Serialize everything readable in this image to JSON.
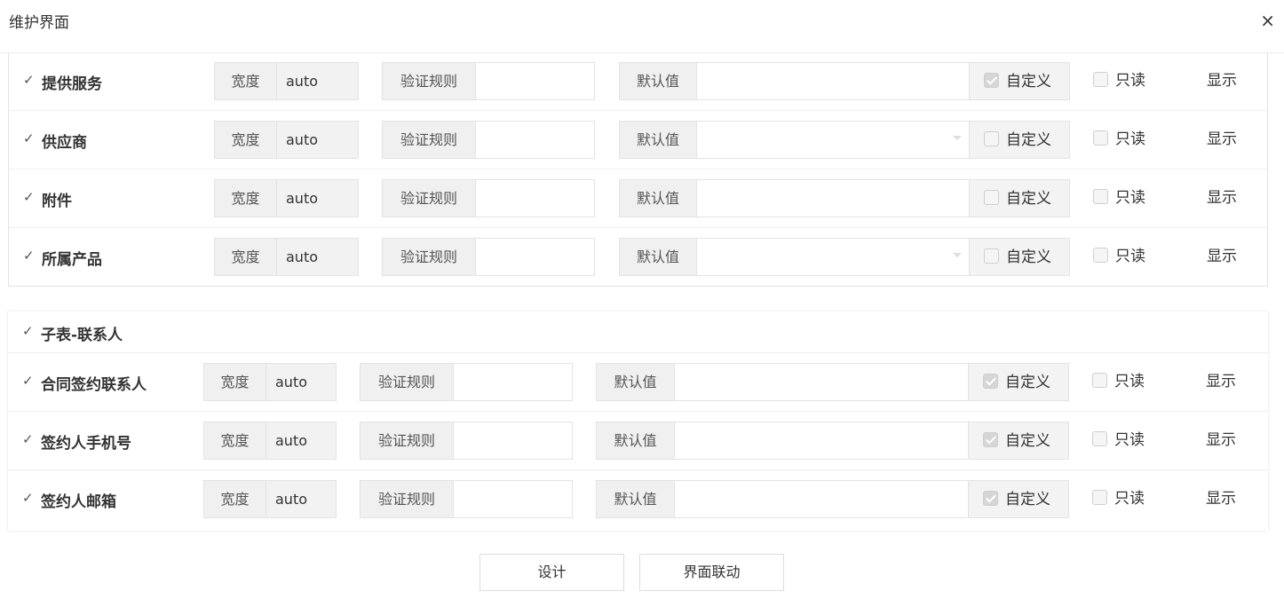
{
  "dialog": {
    "title": "维护界面",
    "close": "×"
  },
  "labels": {
    "width": "宽度",
    "rule": "验证规则",
    "default": "默认值",
    "custom": "自定义",
    "readonly": "只读",
    "display": "显示",
    "check": "✓"
  },
  "section1": {
    "rows": [
      {
        "name": "提供服务",
        "width_value": "auto",
        "custom_checked": true,
        "dropdown": false
      },
      {
        "name": "供应商",
        "width_value": "auto",
        "custom_checked": false,
        "dropdown": true
      },
      {
        "name": "附件",
        "width_value": "auto",
        "custom_checked": false,
        "dropdown": false
      },
      {
        "name": "所属产品",
        "width_value": "auto",
        "custom_checked": false,
        "dropdown": true
      }
    ]
  },
  "section2": {
    "title": "子表-联系人",
    "rows": [
      {
        "name": "合同签约联系人",
        "width_value": "auto",
        "custom_checked": true
      },
      {
        "name": "签约人手机号",
        "width_value": "auto",
        "custom_checked": true
      },
      {
        "name": "签约人邮箱",
        "width_value": "auto",
        "custom_checked": true
      }
    ]
  },
  "footer": {
    "design_label": "设计",
    "linkage_label": "界面联动"
  }
}
